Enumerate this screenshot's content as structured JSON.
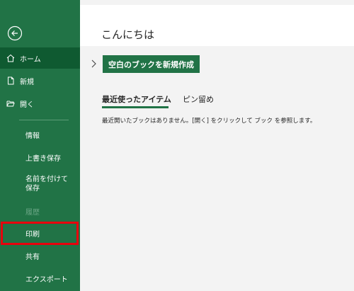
{
  "sidebar": {
    "back_label": "",
    "items": [
      {
        "label": "ホーム"
      },
      {
        "label": "新規"
      },
      {
        "label": "開く"
      },
      {
        "label": "情報"
      },
      {
        "label": "上書き保存"
      },
      {
        "label": "名前を付けて保存"
      },
      {
        "label": "履歴"
      },
      {
        "label": "印刷"
      },
      {
        "label": "共有"
      },
      {
        "label": "エクスポート"
      }
    ]
  },
  "main": {
    "greeting": "こんにちは",
    "new_blank_label": "空白のブックを新規作成",
    "tabs": [
      {
        "label": "最近使ったアイテム"
      },
      {
        "label": "ピン留め"
      }
    ],
    "empty_message": "最近開いたブックはありません。[開く] をクリックして ブック を参照します。"
  },
  "colors": {
    "sidebar_bg": "#217346",
    "sidebar_active": "#0f5a31",
    "highlight": "#e8000d",
    "accent": "#217346"
  }
}
